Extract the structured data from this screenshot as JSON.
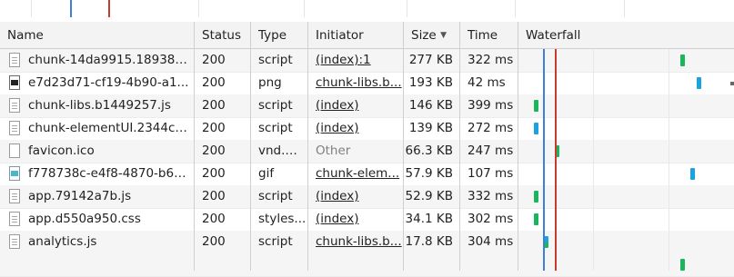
{
  "columns": {
    "name": "Name",
    "status": "Status",
    "type": "Type",
    "initiator": "Initiator",
    "size": "Size",
    "time": "Time",
    "waterfall": "Waterfall"
  },
  "sort": {
    "column": "size",
    "direction": "descending",
    "icon": "sort-descending-icon"
  },
  "colors": {
    "dom_content_loaded": "#3f7fd6",
    "load_event": "#c83a32",
    "waiting": "#1bb55c",
    "content_download": "#1ba3e0"
  },
  "requests": [
    {
      "name": "chunk-14da9915.18938b...",
      "status": "200",
      "type": "script",
      "initiator": "(index):1",
      "initiator_style": "link",
      "size": "277 KB",
      "time": "322 ms",
      "icon": "script-file-icon"
    },
    {
      "name": "e7d23d71-cf19-4b90-a1...",
      "status": "200",
      "type": "png",
      "initiator": "chunk-libs.b...",
      "initiator_style": "link",
      "size": "193 KB",
      "time": "42 ms",
      "icon": "image-file-icon"
    },
    {
      "name": "chunk-libs.b1449257.js",
      "status": "200",
      "type": "script",
      "initiator": "(index)",
      "initiator_style": "link",
      "size": "146 KB",
      "time": "399 ms",
      "icon": "script-file-icon"
    },
    {
      "name": "chunk-elementUI.2344c1...",
      "status": "200",
      "type": "script",
      "initiator": "(index)",
      "initiator_style": "link",
      "size": "139 KB",
      "time": "272 ms",
      "icon": "script-file-icon"
    },
    {
      "name": "favicon.ico",
      "status": "200",
      "type": "vnd.m...",
      "initiator": "Other",
      "initiator_style": "muted",
      "size": "66.3 KB",
      "time": "247 ms",
      "icon": "file-icon"
    },
    {
      "name": "f778738c-e4f8-4870-b63...",
      "status": "200",
      "type": "gif",
      "initiator": "chunk-elem...",
      "initiator_style": "link",
      "size": "57.9 KB",
      "time": "107 ms",
      "icon": "gif-file-icon"
    },
    {
      "name": "app.79142a7b.js",
      "status": "200",
      "type": "script",
      "initiator": "(index)",
      "initiator_style": "link",
      "size": "52.9 KB",
      "time": "332 ms",
      "icon": "script-file-icon"
    },
    {
      "name": "app.d550a950.css",
      "status": "200",
      "type": "styles...",
      "initiator": "(index)",
      "initiator_style": "link",
      "size": "34.1 KB",
      "time": "302 ms",
      "icon": "stylesheet-file-icon"
    },
    {
      "name": "analytics.js",
      "status": "200",
      "type": "script",
      "initiator": "chunk-libs.b...",
      "initiator_style": "link",
      "size": "17.8 KB",
      "time": "304 ms",
      "icon": "script-file-icon"
    }
  ]
}
